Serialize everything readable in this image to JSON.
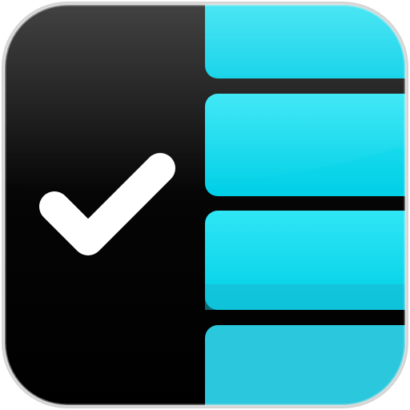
{
  "app_icon": {
    "icon_name": "checklist-app-icon",
    "check_icon": "checkmark-icon",
    "task_bar_count": 4
  },
  "colors": {
    "background_dark": "#050505",
    "accent": "#00d6eb",
    "accent_light": "#2fe6f5",
    "check": "#ffffff",
    "border": "#c8c8c8"
  }
}
